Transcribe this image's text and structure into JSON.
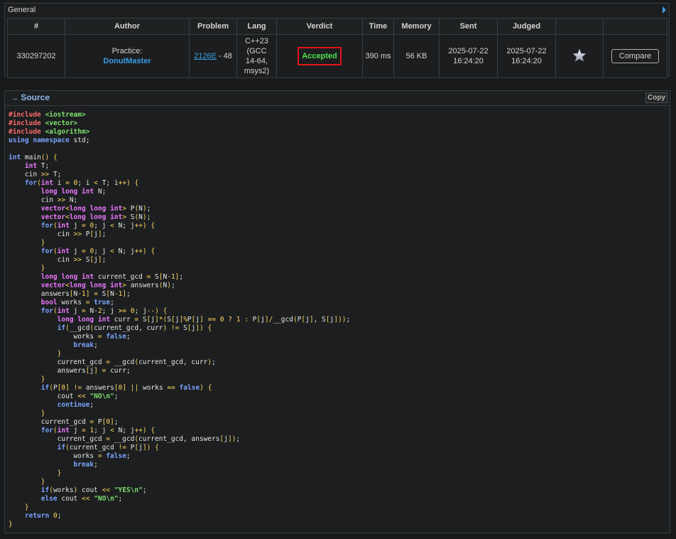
{
  "general": {
    "title": "General",
    "headers": [
      "#",
      "Author",
      "Problem",
      "Lang",
      "Verdict",
      "Time",
      "Memory",
      "Sent",
      "Judged",
      "",
      ""
    ],
    "row": {
      "id": "330297202",
      "author_prefix": "Practice:",
      "author_name": "DonutMaster",
      "problem_link": "2126E",
      "problem_suffix": " - 48",
      "lang_lines": [
        "C++23",
        "(GCC",
        "14-64,",
        "msys2)"
      ],
      "verdict": "Accepted",
      "time": "390 ms",
      "memory": "56 KB",
      "sent_date": "2025-07-22",
      "sent_time": "16:24:20",
      "judged_date": "2025-07-22",
      "judged_time": "16:24:20",
      "compare_label": "Compare"
    }
  },
  "source": {
    "arrow": "→",
    "title": "Source",
    "copy_label": "Copy",
    "code_lines": [
      "#include <iostream>",
      "#include <vector>",
      "#include <algorithm>",
      "using namespace std;",
      "",
      "int main() {",
      "    int T;",
      "    cin >> T;",
      "    for(int i = 0; i < T; i++) {",
      "        long long int N;",
      "        cin >> N;",
      "        vector<long long int> P(N);",
      "        vector<long long int> S(N);",
      "        for(int j = 0; j < N; j++) {",
      "            cin >> P[j];",
      "        }",
      "        for(int j = 0; j < N; j++) {",
      "            cin >> S[j];",
      "        }",
      "        long long int current_gcd = S[N-1];",
      "        vector<long long int> answers(N);",
      "        answers[N-1] = S[N-1];",
      "        bool works = true;",
      "        for(int j = N-2; j >= 0; j--) {",
      "            long long int curr = S[j]*(S[j]%P[j] == 0 ? 1 : P[j]/__gcd(P[j], S[j]));",
      "            if(__gcd(current_gcd, curr) != S[j]) {",
      "                works = false;",
      "                break;",
      "            }",
      "            current_gcd = __gcd(current_gcd, curr);",
      "            answers[j] = curr;",
      "        }",
      "        if(P[0] != answers[0] || works == false) {",
      "            cout << \"NO\\n\";",
      "            continue;",
      "        }",
      "        current_gcd = P[0];",
      "        for(int j = 1; j < N; j++) {",
      "            current_gcd = __gcd(current_gcd, answers[j]);",
      "            if(current_gcd != P[j]) {",
      "                works = false;",
      "                break;",
      "            }",
      "        }",
      "        if(works) cout << \"YES\\n\";",
      "        else cout << \"NO\\n\";",
      "    }",
      "    return 0;",
      "}"
    ]
  },
  "colors": {
    "accent": "#3b9ee6",
    "verdict_ok": "#4fe34f",
    "verdict_border": "#e0141c"
  },
  "icons": {
    "general_toggle": "triangle-right-icon",
    "favorite": "star-icon",
    "source_arrow": "arrow-right-icon"
  }
}
